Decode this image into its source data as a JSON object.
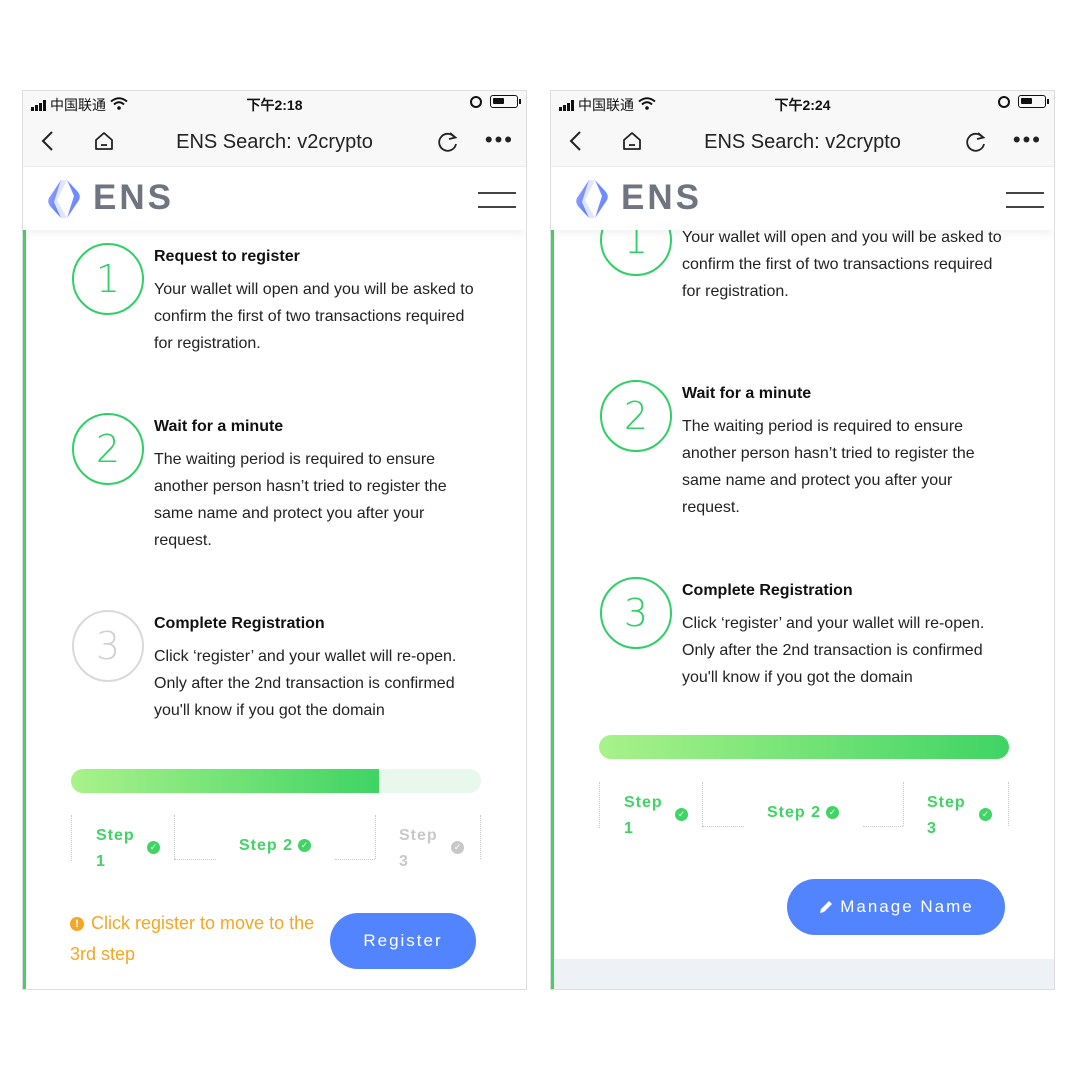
{
  "colors": {
    "accent_green": "#3fd464",
    "button_blue": "#5284ff",
    "warning_orange": "#f5a623",
    "inactive_gray": "#d0d0d0"
  },
  "screens": [
    {
      "status": {
        "carrier": "中国联通",
        "time": "下午2:18"
      },
      "nav": {
        "title": "ENS Search: v2crypto",
        "more_label": "•••"
      },
      "header": {
        "brand": "ENS"
      },
      "steps": [
        {
          "number": "1",
          "title": "Request to register",
          "desc": "Your wallet will open and you will be asked to confirm the first of two transactions required for registration.",
          "state": "done"
        },
        {
          "number": "2",
          "title": "Wait for a minute",
          "desc": "The waiting period is required to ensure another person hasn’t tried to register the same name and protect you after your request.",
          "state": "done"
        },
        {
          "number": "3",
          "title": "Complete Registration",
          "desc": "Click ‘register’ and your wallet will re-open. Only after the 2nd transaction is confirmed you'll know if you got the domain",
          "state": "pending"
        }
      ],
      "progress": 0.75,
      "step_labels": {
        "s1": "Step",
        "s1_num": "1",
        "s2": "Step 2",
        "s3": "Step",
        "s3_num": "3"
      },
      "warning": "Click register to move to the 3rd step",
      "button": "Register"
    },
    {
      "status": {
        "carrier": "中国联通",
        "time": "下午2:24"
      },
      "nav": {
        "title": "ENS Search: v2crypto",
        "more_label": "•••"
      },
      "header": {
        "brand": "ENS"
      },
      "steps": [
        {
          "number": "1",
          "desc": "Your wallet will open and you will be asked to confirm the first of two transactions required for registration.",
          "state": "done"
        },
        {
          "number": "2",
          "title": "Wait for a minute",
          "desc": "The waiting period is required to ensure another person hasn’t tried to register the same name and protect you after your request.",
          "state": "done"
        },
        {
          "number": "3",
          "title": "Complete Registration",
          "desc": "Click ‘register’ and your wallet will re-open. Only after the 2nd transaction is confirmed you'll know if you got the domain",
          "state": "done"
        }
      ],
      "progress": 1.0,
      "step_labels": {
        "s1": "Step",
        "s1_num": "1",
        "s2": "Step 2",
        "s3": "Step",
        "s3_num": "3"
      },
      "button": "Manage Name"
    }
  ]
}
